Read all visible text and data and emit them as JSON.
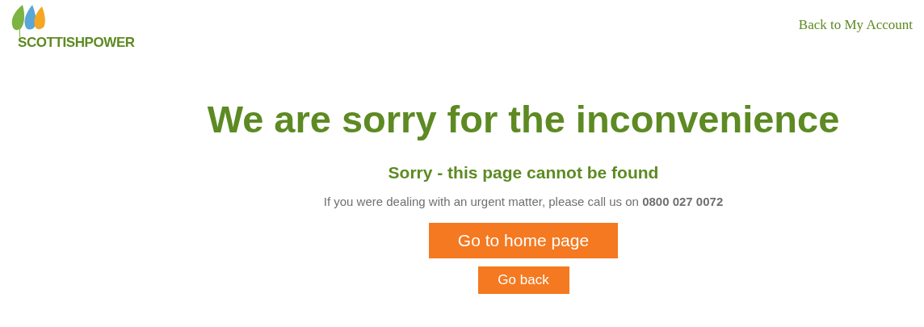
{
  "header": {
    "logo_text": "SCOTTISHPOWER",
    "account_link": "Back to My Account"
  },
  "main": {
    "title": "We are sorry for the inconvenience",
    "subtitle": "Sorry - this page cannot be found",
    "message": "If you were dealing with an urgent matter, please call us on **0800 027 0072**",
    "buttons": [
      {
        "label": "Go to home page",
        "kind": "primary"
      },
      {
        "label": "Go back",
        "kind": "secondary"
      }
    ]
  }
}
